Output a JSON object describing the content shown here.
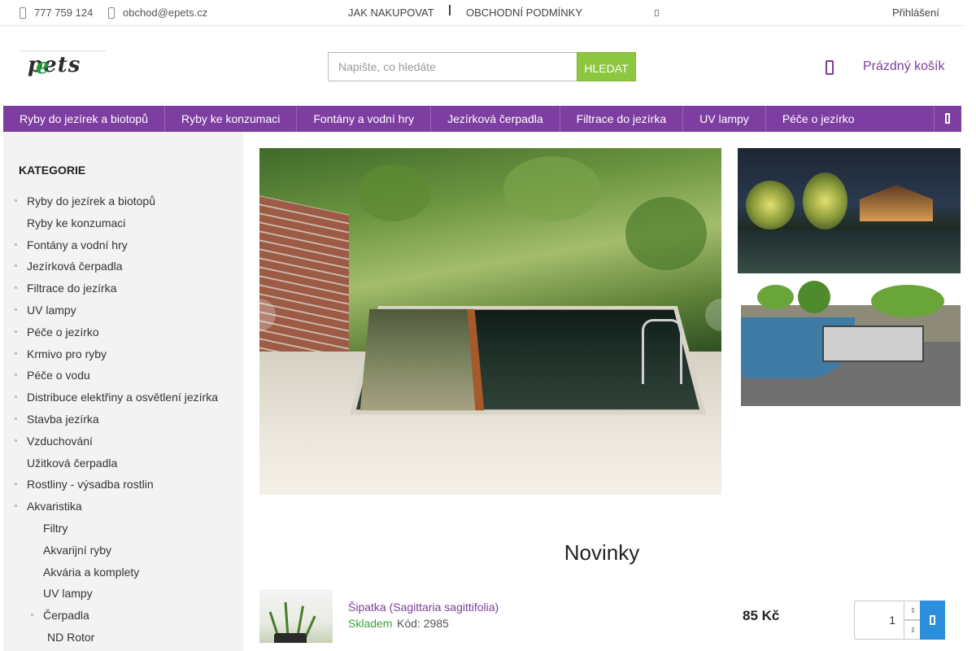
{
  "topbar": {
    "phone": "777 759 124",
    "email": "obchod@epets.cz",
    "links": [
      "JAK NAKUPOVAT",
      "OBCHODNÍ PODMÍNKY"
    ],
    "login": "Přihlášení"
  },
  "header": {
    "logo_text": "epets",
    "search_placeholder": "Napište, co hledáte",
    "search_button": "HLEDAT",
    "cart_label": "Prázdný košík"
  },
  "nav": {
    "items": [
      "Ryby do jezírek a biotopů",
      "Ryby ke konzumaci",
      "Fontány a vodní hry",
      "Jezírková čerpadla",
      "Filtrace do jezírka",
      "UV lampy",
      "Péče o jezírko"
    ]
  },
  "sidebar": {
    "title": "KATEGORIE",
    "categories": [
      {
        "label": "Ryby do jezírek a biotopů",
        "bullet": true
      },
      {
        "label": "Ryby ke konzumaci",
        "bullet": false
      },
      {
        "label": "Fontány a vodní hry",
        "bullet": true
      },
      {
        "label": "Jezírková čerpadla",
        "bullet": true
      },
      {
        "label": "Filtrace do jezírka",
        "bullet": true
      },
      {
        "label": "UV lampy",
        "bullet": true
      },
      {
        "label": "Péče o jezírko",
        "bullet": true
      },
      {
        "label": "Krmivo pro ryby",
        "bullet": true
      },
      {
        "label": "Péče o vodu",
        "bullet": true
      },
      {
        "label": "Distribuce elektřiny a osvětlení jezírka",
        "bullet": true
      },
      {
        "label": "Stavba jezírka",
        "bullet": true
      },
      {
        "label": "Vzduchování",
        "bullet": true
      },
      {
        "label": "Užitková čerpadla",
        "bullet": false
      },
      {
        "label": "Rostliny - výsadba rostlin",
        "bullet": true
      },
      {
        "label": "Akvaristika",
        "bullet": true
      }
    ],
    "subcategories": [
      {
        "label": "Filtry",
        "bullet": false
      },
      {
        "label": "Akvarijní ryby",
        "bullet": false
      },
      {
        "label": "Akvária a komplety",
        "bullet": false
      },
      {
        "label": "UV lampy",
        "bullet": false
      },
      {
        "label": "Čerpadla",
        "bullet": true
      }
    ],
    "subsubcategories": [
      {
        "label": "ND Rotor",
        "bullet": false
      }
    ]
  },
  "news": {
    "title": "Novinky",
    "product": {
      "name": "Šipatka (Sagittaria sagittifolia)",
      "stock": "Skladem",
      "code": "Kód: 2985",
      "price": "85 Kč",
      "quantity": "1"
    }
  },
  "colors": {
    "brand": "#7e3da1",
    "search_button": "#8dc63f",
    "stock": "#3aa538",
    "add_to_cart": "#2c8fdb"
  }
}
